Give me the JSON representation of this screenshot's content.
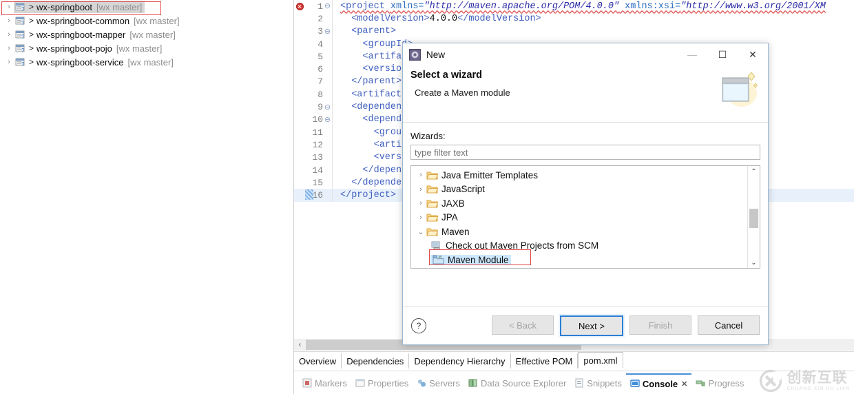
{
  "explorer": {
    "projects": [
      {
        "name": "wx-springboot",
        "branch": "[wx master]",
        "selected": true
      },
      {
        "name": "wx-springboot-common",
        "branch": "[wx master]",
        "selected": false
      },
      {
        "name": "wx-springboot-mapper",
        "branch": "[wx master]",
        "selected": false
      },
      {
        "name": "wx-springboot-pojo",
        "branch": "[wx master]",
        "selected": false
      },
      {
        "name": "wx-springboot-service",
        "branch": "[wx master]",
        "selected": false
      }
    ],
    "arrow": ">",
    "twisty": "›"
  },
  "editor": {
    "lines": [
      {
        "no": "1",
        "fold": true,
        "error": true,
        "indent": 0,
        "segments": [
          {
            "t": "<project ",
            "c": "tag"
          },
          {
            "t": "xmlns=",
            "c": "attr"
          },
          {
            "t": "\"http://maven.apache.org/POM/4.0.0\"",
            "c": "val"
          },
          {
            "t": " xmlns:xsi=",
            "c": "attr"
          },
          {
            "t": "\"http://www.w3.org/2001/XM",
            "c": "val"
          }
        ]
      },
      {
        "no": "2",
        "fold": false,
        "error": false,
        "indent": 1,
        "segments": [
          {
            "t": "<modelVersion>",
            "c": "tag"
          },
          {
            "t": "4.0.0",
            "c": "txt"
          },
          {
            "t": "</modelVersion>",
            "c": "tag"
          }
        ]
      },
      {
        "no": "3",
        "fold": true,
        "error": false,
        "indent": 1,
        "segments": [
          {
            "t": "<parent>",
            "c": "tag"
          }
        ]
      },
      {
        "no": "4",
        "fold": false,
        "error": false,
        "indent": 2,
        "segments": [
          {
            "t": "<groupId>",
            "c": "tag"
          }
        ]
      },
      {
        "no": "5",
        "fold": false,
        "error": false,
        "indent": 2,
        "segments": [
          {
            "t": "<artifact",
            "c": "tag"
          }
        ]
      },
      {
        "no": "6",
        "fold": false,
        "error": false,
        "indent": 2,
        "segments": [
          {
            "t": "<version>",
            "c": "tag"
          }
        ]
      },
      {
        "no": "7",
        "fold": false,
        "error": false,
        "indent": 1,
        "segments": [
          {
            "t": "</parent>",
            "c": "tag"
          }
        ]
      },
      {
        "no": "8",
        "fold": false,
        "error": false,
        "indent": 1,
        "segments": [
          {
            "t": "<artifactId",
            "c": "tag"
          }
        ]
      },
      {
        "no": "9",
        "fold": true,
        "error": false,
        "indent": 1,
        "segments": [
          {
            "t": "<dependenci",
            "c": "tag"
          }
        ]
      },
      {
        "no": "10",
        "fold": true,
        "error": false,
        "indent": 2,
        "segments": [
          {
            "t": "<dependen",
            "c": "tag"
          }
        ]
      },
      {
        "no": "11",
        "fold": false,
        "error": false,
        "indent": 3,
        "segments": [
          {
            "t": "<grou",
            "c": "tag"
          }
        ]
      },
      {
        "no": "12",
        "fold": false,
        "error": false,
        "indent": 3,
        "segments": [
          {
            "t": "<arti",
            "c": "tag"
          }
        ]
      },
      {
        "no": "13",
        "fold": false,
        "error": false,
        "indent": 3,
        "segments": [
          {
            "t": "<vers",
            "c": "tag"
          }
        ]
      },
      {
        "no": "14",
        "fold": false,
        "error": false,
        "indent": 2,
        "segments": [
          {
            "t": "</depende",
            "c": "tag"
          }
        ]
      },
      {
        "no": "15",
        "fold": false,
        "error": false,
        "indent": 1,
        "segments": [
          {
            "t": "</dependenc",
            "c": "tag"
          }
        ]
      },
      {
        "no": "16",
        "fold": false,
        "error": false,
        "indent": 0,
        "current": true,
        "segments": [
          {
            "t": "</project>",
            "c": "tag"
          }
        ]
      }
    ],
    "scroll_left_arrow": "‹",
    "tabs": [
      {
        "label": "Overview",
        "active": false
      },
      {
        "label": "Dependencies",
        "active": false
      },
      {
        "label": "Dependency Hierarchy",
        "active": false
      },
      {
        "label": "Effective POM",
        "active": false
      },
      {
        "label": "pom.xml",
        "active": true
      }
    ]
  },
  "viewbar": {
    "tabs": [
      {
        "label": "Markers",
        "icon": "markers-icon",
        "active": false,
        "closeable": false
      },
      {
        "label": "Properties",
        "icon": "properties-icon",
        "active": false,
        "closeable": false
      },
      {
        "label": "Servers",
        "icon": "servers-icon",
        "active": false,
        "closeable": false
      },
      {
        "label": "Data Source Explorer",
        "icon": "database-icon",
        "active": false,
        "closeable": false
      },
      {
        "label": "Snippets",
        "icon": "snippets-icon",
        "active": false,
        "closeable": false
      },
      {
        "label": "Console",
        "icon": "console-icon",
        "active": true,
        "closeable": true
      },
      {
        "label": "Progress",
        "icon": "progress-icon",
        "active": false,
        "closeable": false
      }
    ],
    "close_glyph": "✕"
  },
  "watermark": {
    "cn": "创新互联",
    "en": "CHUANG XIN HU LIAN"
  },
  "dialog": {
    "title": "New",
    "minimize": "—",
    "maximize": "☐",
    "close": "✕",
    "heading": "Select a wizard",
    "subheading": "Create a Maven module",
    "wizards_label": "Wizards:",
    "filter_placeholder": "type filter text",
    "filter_value": "",
    "tree": [
      {
        "label": "Java Emitter Templates",
        "level": 0,
        "expanded": false,
        "type": "folder",
        "selected": false
      },
      {
        "label": "JavaScript",
        "level": 0,
        "expanded": false,
        "type": "folder",
        "selected": false
      },
      {
        "label": "JAXB",
        "level": 0,
        "expanded": false,
        "type": "folder",
        "selected": false
      },
      {
        "label": "JPA",
        "level": 0,
        "expanded": false,
        "type": "folder",
        "selected": false
      },
      {
        "label": "Maven",
        "level": 0,
        "expanded": true,
        "type": "folder",
        "selected": false
      },
      {
        "label": "Check out Maven Projects from SCM",
        "level": 1,
        "expanded": false,
        "type": "scm",
        "selected": false
      },
      {
        "label": "Maven Module",
        "level": 1,
        "expanded": false,
        "type": "module",
        "selected": true
      }
    ],
    "twisty_collapsed": "›",
    "twisty_expanded": "⌄",
    "scroll_up": "⌃",
    "scroll_down": "⌄",
    "help": "?",
    "buttons": [
      {
        "label": "< Back",
        "state": "disabled"
      },
      {
        "label": "Next >",
        "state": "primary"
      },
      {
        "label": "Finish",
        "state": "disabled"
      },
      {
        "label": "Cancel",
        "state": "plain"
      }
    ]
  },
  "colors": {
    "accent": "#2a7fd4",
    "selection": "#cde8ff",
    "annotation": "#e04a4a",
    "error": "#d63a34"
  }
}
